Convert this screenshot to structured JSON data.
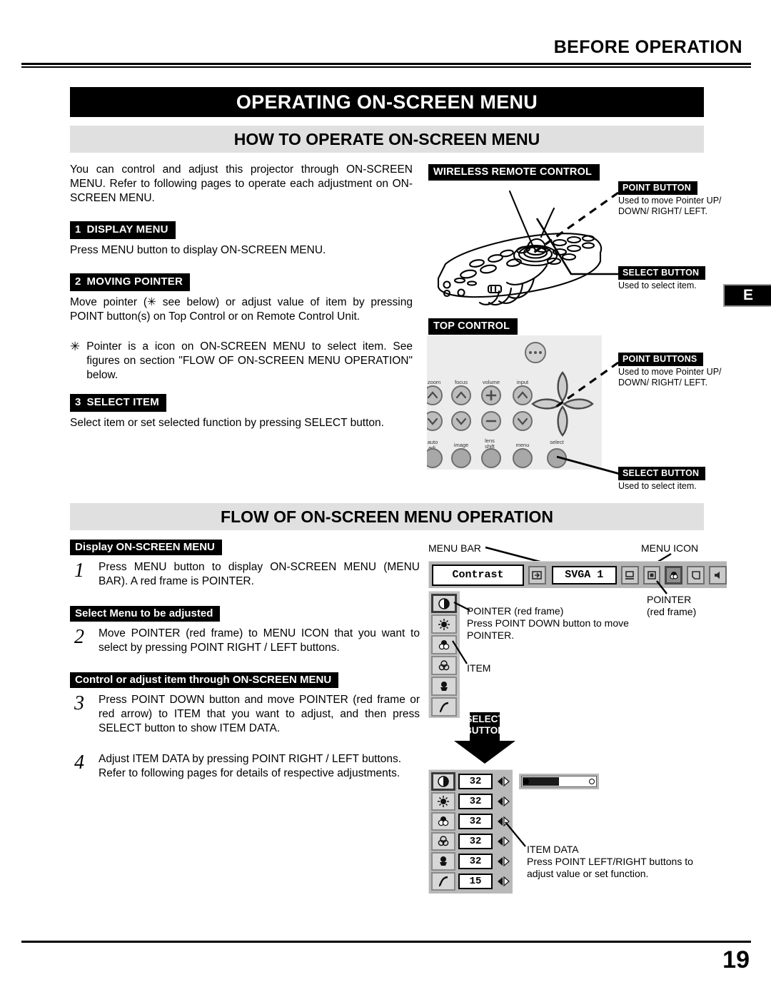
{
  "running_head": "BEFORE OPERATION",
  "title_banner": "OPERATING ON-SCREEN MENU",
  "language_tab": "E",
  "page_number": "19",
  "section_how": {
    "heading": "HOW TO OPERATE ON-SCREEN MENU",
    "intro": "You can control and adjust this projector through ON-SCREEN MENU.  Refer to following pages to operate each adjustment on ON-SCREEN MENU.",
    "steps": [
      {
        "num": "1",
        "label": "DISPLAY MENU",
        "body": "Press MENU button to display ON-SCREEN MENU."
      },
      {
        "num": "2",
        "label": "MOVING POINTER",
        "body": "Move pointer (✳ see below) or adjust value of item by pressing POINT button(s) on Top Control or on Remote Control Unit."
      },
      {
        "num": "3",
        "label": "SELECT ITEM",
        "body": "Select item or set selected function by pressing SELECT button."
      }
    ],
    "footnote_marker": "✳",
    "footnote": "Pointer is a icon on ON-SCREEN MENU to select item. See figures on section \"FLOW OF ON-SCREEN MENU OPERATION\" below."
  },
  "remote_figure": {
    "tag": "WIRELESS REMOTE CONTROL",
    "point_button": {
      "tag": "POINT BUTTON",
      "caption": "Used to move Pointer UP/ DOWN/ RIGHT/ LEFT."
    },
    "select_button": {
      "tag": "SELECT BUTTON",
      "caption": "Used to select item."
    }
  },
  "top_control_figure": {
    "tag": "TOP CONTROL",
    "point_buttons": {
      "tag": "POINT BUTTONS",
      "caption": "Used to move Pointer UP/ DOWN/ RIGHT/ LEFT."
    },
    "select_button": {
      "tag": "SELECT BUTTON",
      "caption": "Used to select item."
    },
    "button_labels": [
      "zoom",
      "focus",
      "volume",
      "input",
      "auto adj.",
      "image",
      "lens shift",
      "menu",
      "select"
    ]
  },
  "section_flow": {
    "heading": "FLOW OF ON-SCREEN MENU OPERATION",
    "steps": [
      {
        "num": "1",
        "head": "Display ON-SCREEN MENU",
        "body": "Press MENU button to display ON-SCREEN MENU (MENU BAR).  A red frame is POINTER."
      },
      {
        "num": "2",
        "head": "Select Menu to be adjusted",
        "body": "Move POINTER (red frame) to MENU ICON that you want to select by pressing POINT RIGHT / LEFT buttons."
      },
      {
        "num": "3",
        "head": "Control or adjust item through ON-SCREEN MENU",
        "body": "Press POINT DOWN button and move POINTER (red frame or red arrow) to ITEM that you want to adjust, and then press SELECT button to show ITEM DATA."
      },
      {
        "num": "4",
        "head": "",
        "body": "Adjust ITEM DATA by pressing POINT RIGHT / LEFT buttons.",
        "body2": "Refer to following pages for details of respective adjustments."
      }
    ]
  },
  "menu_figure": {
    "label_menu_bar": "MENU BAR",
    "label_menu_icon": "MENU ICON",
    "label_pointer": "POINTER",
    "label_pointer_sub": "(red frame)",
    "contrast_box": "Contrast",
    "source_box": "SVGA 1",
    "pointer_note_title": "POINTER (red frame)",
    "pointer_note_body": "Press POINT DOWN button to move POINTER.",
    "item_label": "ITEM",
    "select_arrow_line1": "SELECT",
    "select_arrow_line2": "BUTTON",
    "item_data_title": "ITEM DATA",
    "item_data_body": "Press POINT LEFT/RIGHT buttons to adjust value or set function.",
    "item_icons": [
      "contrast-icon",
      "brightness-icon",
      "color-icon",
      "tint-icon",
      "white-balance-icon",
      "gamma-icon"
    ],
    "item_values": [
      "32",
      "32",
      "32",
      "32",
      "32",
      "15"
    ],
    "slider_fill_percent": 49,
    "colors": {
      "panel_grey": "#b9b9b9",
      "menubar_grey": "#b5b5b5",
      "section_head_grey": "#e0e0e0",
      "banner_black": "#000000"
    }
  }
}
